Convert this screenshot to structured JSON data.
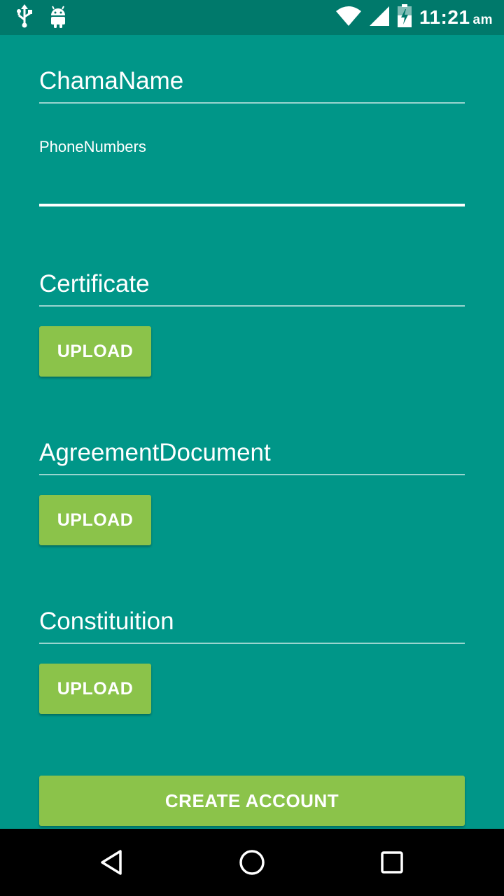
{
  "status_bar": {
    "icons": [
      "usb-icon",
      "android-debug-icon",
      "wifi-icon",
      "cell-signal-icon",
      "battery-charging-icon"
    ],
    "time": "11:21",
    "ampm": "am"
  },
  "form": {
    "chama_name": {
      "value": "ChamaName"
    },
    "phone_numbers": {
      "label": "PhoneNumbers",
      "value": ""
    },
    "certificate": {
      "value": "Certificate",
      "button": "UPLOAD"
    },
    "agreement": {
      "value": "AgreementDocument",
      "button": "UPLOAD"
    },
    "constitution": {
      "value": "Constituition",
      "button": "UPLOAD"
    },
    "submit": "CREATE ACCOUNT"
  },
  "colors": {
    "background": "#009688",
    "status_bar": "#00796b",
    "button": "#8bc34a",
    "nav_bar": "#000000"
  },
  "nav_bar": {
    "icons": [
      "back-icon",
      "home-icon",
      "recents-icon"
    ]
  }
}
